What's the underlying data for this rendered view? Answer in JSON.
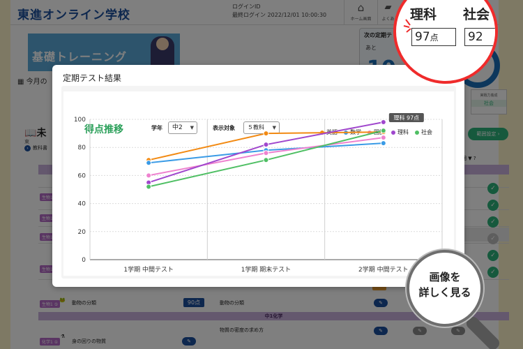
{
  "header": {
    "logo": "東進オンライン学校",
    "login_id_label": "ログインID",
    "last_login": "最終ログイン 2022/12/01 10:00:30",
    "nav_home_label": "ホーム画面",
    "nav_faq_label": "よくあ"
  },
  "banner": {
    "title": "基礎トレーニング"
  },
  "month_label": "今月の",
  "next_test": {
    "title": "次の定期テ",
    "until": "あと",
    "days": "10",
    "ring_label": "時間"
  },
  "score_mini": {
    "label": "実戦力養成",
    "value": "社会"
  },
  "section": {
    "head": "未",
    "sub": "東",
    "link": "教科書"
  },
  "range_button": "範囲設定 ›",
  "col_head": "範囲",
  "rows": [
    {
      "tag": "生物1 ①"
    },
    {
      "tag": "生物1 ②"
    },
    {
      "tag": "生物1 ③"
    },
    {
      "tag": "生物1 ④"
    },
    {
      "tag": "生物1 ⑤"
    }
  ],
  "bottom": {
    "row1_tag": "生物1 ⑤",
    "row1_title": "動物の分類",
    "row1_score": "90点",
    "row1_right": "動物の分類",
    "chem_bar": "中1化学",
    "row2_tag": "化学1 ①",
    "row2_title": "身の回りの物質",
    "row2_right": "物質の密度の求め方"
  },
  "modal": {
    "title": "定期テスト結果",
    "close": "×",
    "chart_title": "得点推移",
    "grade_label": "学年",
    "grade_value": "中2",
    "subject_label": "表示対象",
    "subject_value": "５教科",
    "tooltip": "理科 97点"
  },
  "magnifier": {
    "head1": "理科",
    "head2": "社会",
    "score1_num": "97",
    "score1_unit": "点",
    "score2_num": "92"
  },
  "detail_lens": {
    "line1": "画像を",
    "line2": "詳しく見る"
  },
  "colors": {
    "english": "#f28a13",
    "math": "#3a9be6",
    "japanese": "#ee82cf",
    "science": "#a047cd",
    "social": "#4fbf64"
  },
  "chart_data": {
    "type": "line",
    "categories": [
      "1学期 中間テスト",
      "1学期 期末テスト",
      "2学期 中間テスト"
    ],
    "ylim": [
      0,
      100
    ],
    "yticks": [
      0,
      20,
      40,
      60,
      80,
      100
    ],
    "grid": true,
    "legend_position": "top-right",
    "series": [
      {
        "name": "英語",
        "color": "#f28a13",
        "values": [
          71,
          90,
          91
        ]
      },
      {
        "name": "数学",
        "color": "#3a9be6",
        "values": [
          69,
          78,
          83
        ]
      },
      {
        "name": "国語",
        "color": "#ee82cf",
        "values": [
          60,
          76,
          87
        ]
      },
      {
        "name": "理科",
        "color": "#a047cd",
        "values": [
          55,
          82,
          98
        ]
      },
      {
        "name": "社会",
        "color": "#4fbf64",
        "values": [
          52,
          71,
          92
        ]
      }
    ]
  }
}
